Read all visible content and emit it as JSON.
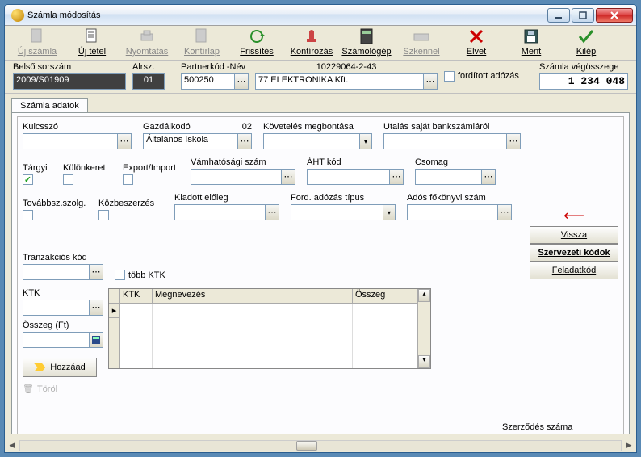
{
  "window": {
    "title": "Számla módosítás"
  },
  "toolbar": [
    {
      "label": "Új számla",
      "icon": "doc",
      "enabled": false,
      "name": "new-invoice"
    },
    {
      "label": "Új tétel",
      "icon": "doc-lines",
      "enabled": true,
      "name": "new-item"
    },
    {
      "label": "Nyomtatás",
      "icon": "printer",
      "enabled": false,
      "name": "print"
    },
    {
      "label": "Kontírlap",
      "icon": "sheet",
      "enabled": false,
      "name": "accounting-sheet"
    },
    {
      "label": "Frissítés",
      "icon": "refresh",
      "enabled": true,
      "name": "refresh"
    },
    {
      "label": "Kontírozás",
      "icon": "stamp",
      "enabled": true,
      "name": "posting"
    },
    {
      "label": "Számológép",
      "icon": "calc",
      "enabled": true,
      "name": "calculator"
    },
    {
      "label": "Szkennel",
      "icon": "scanner",
      "enabled": false,
      "name": "scan"
    },
    {
      "label": "Elvet",
      "icon": "x",
      "enabled": true,
      "name": "discard"
    },
    {
      "label": "Ment",
      "icon": "save",
      "enabled": true,
      "name": "save"
    },
    {
      "label": "Kilép",
      "icon": "check",
      "enabled": true,
      "name": "exit"
    }
  ],
  "header": {
    "belso_sorszam_label": "Belső sorszám",
    "belso_sorszam": "2009/S01909",
    "alrsz_label": "Alrsz.",
    "alrsz": "01",
    "partnerkod_label": "Partnerkód -Név",
    "partnerkod": "500250",
    "partner_nev": "77 ELEKTRONIKA Kft.",
    "taxbox_label": "fordított adózás",
    "taxid": "10229064-2-43",
    "osszeg_label": "Számla végösszege",
    "osszeg": "1 234 048"
  },
  "tab": {
    "label": "Számla adatok"
  },
  "form": {
    "kulcsszo_label": "Kulcsszó",
    "gazdalkodo_label": "Gazdálkodó",
    "gazdalkodo_code": "02",
    "gazdalkodo_value": "Általános Iskola",
    "koveteles_label": "Követelés megbontása",
    "utalas_label": "Utalás saját bankszámláról",
    "targyi_label": "Tárgyi",
    "targyi_checked": true,
    "kulon_label": "Különkeret",
    "expimp_label": "Export/Import",
    "vamhat_label": "Vámhatósági szám",
    "aht_label": "ÁHT kód",
    "csomag_label": "Csomag",
    "tovabb_label": "Továbbsz.szolg.",
    "kozbesz_label": "Közbeszerzés",
    "kiadott_label": "Kiadott előleg",
    "fordado_label": "Ford. adózás típus",
    "adosfokonyv_label": "Adós főkönyvi szám",
    "tranzakcio_label": "Tranzakciós kód",
    "tobbktk_label": "több KTK",
    "ktk_label": "KTK",
    "osszegft_label": "Összeg (Ft)",
    "szerzodes_label": "Szerződés száma"
  },
  "sidebuttons": {
    "back": "Vissza",
    "szerv": "Szervezeti kódok",
    "feladat": "Feladatkód"
  },
  "grid": {
    "cols": [
      "KTK",
      "Megnevezés",
      "Összeg"
    ]
  },
  "buttons": {
    "hozzaad": "Hozzáad",
    "torol": "Töröl"
  }
}
